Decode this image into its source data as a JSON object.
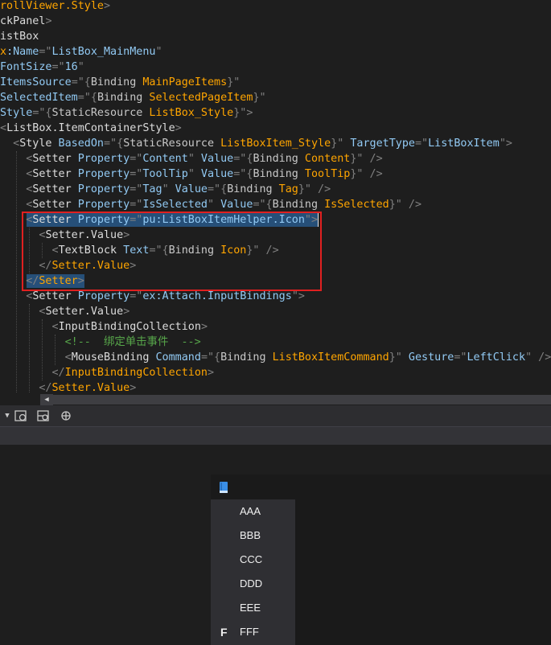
{
  "colors": {
    "editor_bg": "#1e1e1e",
    "tag": "#dcdcdc",
    "attr_name": "#92caf4",
    "attr_value": "#c8c8c8",
    "orange": "#ffa500",
    "punct": "#808080",
    "comment": "#57a64a",
    "selection": "#264f78",
    "highlight_border": "#e02020"
  },
  "code": {
    "lines": [
      [
        {
          "t": "rollViewer.Style",
          "c": "orange"
        },
        {
          "t": ">",
          "c": "punct"
        }
      ],
      [
        {
          "t": "ckPanel",
          "c": "tag"
        },
        {
          "t": ">",
          "c": "punct"
        }
      ],
      [
        {
          "t": "istBox",
          "c": "tag"
        }
      ],
      [
        {
          "t": "x",
          "c": "orange"
        },
        {
          "t": ":Name",
          "c": "attr_name"
        },
        {
          "t": "=\"",
          "c": "punct"
        },
        {
          "t": "ListBox_MainMenu",
          "c": "attr_name"
        },
        {
          "t": "\"",
          "c": "punct"
        }
      ],
      [
        {
          "t": "FontSize",
          "c": "attr_name"
        },
        {
          "t": "=\"",
          "c": "punct"
        },
        {
          "t": "16",
          "c": "attr_name"
        },
        {
          "t": "\"",
          "c": "punct"
        }
      ],
      [
        {
          "t": "ItemsSource",
          "c": "attr_name"
        },
        {
          "t": "=\"{",
          "c": "punct"
        },
        {
          "t": "Binding",
          "c": "attr_value"
        },
        {
          "t": " MainPageItems",
          "c": "orange"
        },
        {
          "t": "}\"",
          "c": "punct"
        }
      ],
      [
        {
          "t": "SelectedItem",
          "c": "attr_name"
        },
        {
          "t": "=\"{",
          "c": "punct"
        },
        {
          "t": "Binding",
          "c": "attr_value"
        },
        {
          "t": " SelectedPageItem",
          "c": "orange"
        },
        {
          "t": "}\"",
          "c": "punct"
        }
      ],
      [
        {
          "t": "Style",
          "c": "attr_name"
        },
        {
          "t": "=\"{",
          "c": "punct"
        },
        {
          "t": "StaticResource",
          "c": "attr_value"
        },
        {
          "t": " ListBox_Style",
          "c": "orange"
        },
        {
          "t": "}\">",
          "c": "punct"
        }
      ],
      [
        {
          "t": "<",
          "c": "punct"
        },
        {
          "t": "ListBox.ItemContainerStyle",
          "c": "tag"
        },
        {
          "t": ">",
          "c": "punct"
        }
      ],
      [
        {
          "t": "  <",
          "c": "punct"
        },
        {
          "t": "Style",
          "c": "tag"
        },
        {
          "t": " BasedOn",
          "c": "attr_name"
        },
        {
          "t": "=\"{",
          "c": "punct"
        },
        {
          "t": "StaticResource",
          "c": "attr_value"
        },
        {
          "t": " ListBoxItem_Style",
          "c": "orange"
        },
        {
          "t": "}\"",
          "c": "punct"
        },
        {
          "t": " TargetType",
          "c": "attr_name"
        },
        {
          "t": "=\"",
          "c": "punct"
        },
        {
          "t": "ListBoxItem",
          "c": "attr_name"
        },
        {
          "t": "\">",
          "c": "punct"
        }
      ],
      [
        {
          "t": "    <",
          "c": "punct"
        },
        {
          "t": "Setter",
          "c": "tag"
        },
        {
          "t": " Property",
          "c": "attr_name"
        },
        {
          "t": "=\"",
          "c": "punct"
        },
        {
          "t": "Content",
          "c": "attr_name"
        },
        {
          "t": "\"",
          "c": "punct"
        },
        {
          "t": " Value",
          "c": "attr_name"
        },
        {
          "t": "=\"{",
          "c": "punct"
        },
        {
          "t": "Binding",
          "c": "attr_value"
        },
        {
          "t": " Content",
          "c": "orange"
        },
        {
          "t": "}\"",
          "c": "punct"
        },
        {
          "t": " />",
          "c": "punct"
        }
      ],
      [
        {
          "t": "    <",
          "c": "punct"
        },
        {
          "t": "Setter",
          "c": "tag"
        },
        {
          "t": " Property",
          "c": "attr_name"
        },
        {
          "t": "=\"",
          "c": "punct"
        },
        {
          "t": "ToolTip",
          "c": "attr_name"
        },
        {
          "t": "\"",
          "c": "punct"
        },
        {
          "t": " Value",
          "c": "attr_name"
        },
        {
          "t": "=\"{",
          "c": "punct"
        },
        {
          "t": "Binding",
          "c": "attr_value"
        },
        {
          "t": " ToolTip",
          "c": "orange"
        },
        {
          "t": "}\"",
          "c": "punct"
        },
        {
          "t": " />",
          "c": "punct"
        }
      ],
      [
        {
          "t": "    <",
          "c": "punct"
        },
        {
          "t": "Setter",
          "c": "tag"
        },
        {
          "t": " Property",
          "c": "attr_name"
        },
        {
          "t": "=\"",
          "c": "punct"
        },
        {
          "t": "Tag",
          "c": "attr_name"
        },
        {
          "t": "\"",
          "c": "punct"
        },
        {
          "t": " Value",
          "c": "attr_name"
        },
        {
          "t": "=\"{",
          "c": "punct"
        },
        {
          "t": "Binding",
          "c": "attr_value"
        },
        {
          "t": " Tag",
          "c": "orange"
        },
        {
          "t": "}\"",
          "c": "punct"
        },
        {
          "t": " />",
          "c": "punct"
        }
      ],
      [
        {
          "t": "    <",
          "c": "punct"
        },
        {
          "t": "Setter",
          "c": "tag"
        },
        {
          "t": " Property",
          "c": "attr_name"
        },
        {
          "t": "=\"",
          "c": "punct"
        },
        {
          "t": "IsSelected",
          "c": "attr_name"
        },
        {
          "t": "\"",
          "c": "punct"
        },
        {
          "t": " Value",
          "c": "attr_name"
        },
        {
          "t": "=\"{",
          "c": "punct"
        },
        {
          "t": "Binding",
          "c": "attr_value"
        },
        {
          "t": " IsSelected",
          "c": "orange"
        },
        {
          "t": "}\"",
          "c": "punct"
        },
        {
          "t": " />",
          "c": "punct"
        }
      ],
      [
        {
          "t": "    <",
          "c": "punct"
        },
        {
          "t": "Setter",
          "c": "tag"
        },
        {
          "t": " Property",
          "c": "attr_name"
        },
        {
          "t": "=\"",
          "c": "punct"
        },
        {
          "t": "pu:ListBoxItemHelper.Icon",
          "c": "attr_name"
        },
        {
          "t": "\">",
          "c": "punct"
        }
      ],
      [
        {
          "t": "      <",
          "c": "punct"
        },
        {
          "t": "Setter.Value",
          "c": "tag"
        },
        {
          "t": ">",
          "c": "punct"
        }
      ],
      [
        {
          "t": "        <",
          "c": "punct"
        },
        {
          "t": "TextBlock",
          "c": "tag"
        },
        {
          "t": " Text",
          "c": "attr_name"
        },
        {
          "t": "=\"{",
          "c": "punct"
        },
        {
          "t": "Binding",
          "c": "attr_value"
        },
        {
          "t": " Icon",
          "c": "orange"
        },
        {
          "t": "}\"",
          "c": "punct"
        },
        {
          "t": " />",
          "c": "punct"
        }
      ],
      [
        {
          "t": "      </",
          "c": "punct"
        },
        {
          "t": "Setter.Value",
          "c": "orange"
        },
        {
          "t": ">",
          "c": "punct"
        }
      ],
      [
        {
          "t": "    </",
          "c": "punct"
        },
        {
          "t": "Setter",
          "c": "orange"
        },
        {
          "t": ">",
          "c": "punct"
        }
      ],
      [
        {
          "t": "    <",
          "c": "punct"
        },
        {
          "t": "Setter",
          "c": "tag"
        },
        {
          "t": " Property",
          "c": "attr_name"
        },
        {
          "t": "=\"",
          "c": "punct"
        },
        {
          "t": "ex:Attach.InputBindings",
          "c": "attr_name"
        },
        {
          "t": "\">",
          "c": "punct"
        }
      ],
      [
        {
          "t": "      <",
          "c": "punct"
        },
        {
          "t": "Setter.Value",
          "c": "tag"
        },
        {
          "t": ">",
          "c": "punct"
        }
      ],
      [
        {
          "t": "        <",
          "c": "punct"
        },
        {
          "t": "InputBindingCollection",
          "c": "tag"
        },
        {
          "t": ">",
          "c": "punct"
        }
      ],
      [
        {
          "t": "          <!--  绑定单击事件  -->",
          "c": "comment"
        }
      ],
      [
        {
          "t": "          <",
          "c": "punct"
        },
        {
          "t": "MouseBinding",
          "c": "tag"
        },
        {
          "t": " Command",
          "c": "attr_name"
        },
        {
          "t": "=\"{",
          "c": "punct"
        },
        {
          "t": "Binding",
          "c": "attr_value"
        },
        {
          "t": " ListBoxItemCommand",
          "c": "orange"
        },
        {
          "t": "}\"",
          "c": "punct"
        },
        {
          "t": " Gesture",
          "c": "attr_name"
        },
        {
          "t": "=\"",
          "c": "punct"
        },
        {
          "t": "LeftClick",
          "c": "attr_name"
        },
        {
          "t": "\"",
          "c": "punct"
        },
        {
          "t": " />",
          "c": "punct"
        }
      ],
      [
        {
          "t": "        </",
          "c": "punct"
        },
        {
          "t": "InputBindingCollection",
          "c": "orange"
        },
        {
          "t": ">",
          "c": "punct"
        }
      ],
      [
        {
          "t": "      </",
          "c": "punct"
        },
        {
          "t": "Setter.Value",
          "c": "orange"
        },
        {
          "t": ">",
          "c": "punct"
        }
      ]
    ]
  },
  "toolbar": {
    "icons": [
      "dropdown-arrow-icon",
      "designer-view-icon",
      "split-view-icon",
      "xaml-view-icon"
    ]
  },
  "scrollbar": {
    "left_arrow": "◀"
  },
  "preview": {
    "header_icon": "book-icon",
    "items": [
      {
        "label": "AAA",
        "icon": ""
      },
      {
        "label": "BBB",
        "icon": ""
      },
      {
        "label": "CCC",
        "icon": ""
      },
      {
        "label": "DDD",
        "icon": ""
      },
      {
        "label": "EEE",
        "icon": ""
      },
      {
        "label": "FFF",
        "icon": "F"
      }
    ]
  }
}
